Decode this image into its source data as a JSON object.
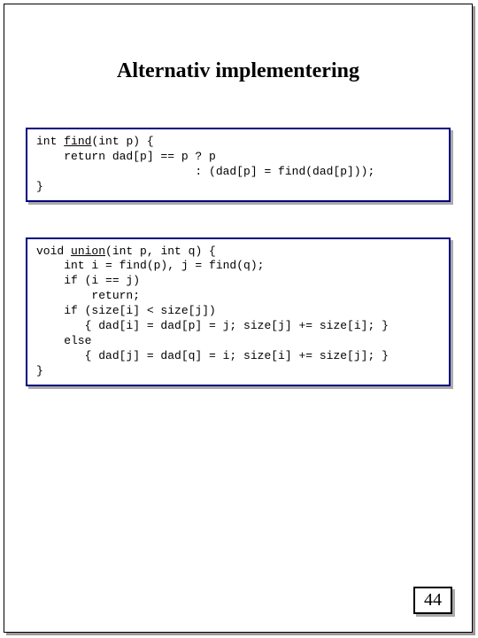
{
  "slide": {
    "title": "Alternativ implementering",
    "page_number": "44",
    "code1": {
      "line1_a": "int ",
      "line1_fn": "find",
      "line1_b": "(int p) {",
      "line2": "    return dad[p] == p ? p",
      "line3": "                       : (dad[p] = find(dad[p]));",
      "line4": "}"
    },
    "code2": {
      "line1_a": "void ",
      "line1_fn": "union",
      "line1_b": "(int p, int q) {",
      "line2": "    int i = find(p), j = find(q);",
      "line3": "    if (i == j)",
      "line4": "        return;",
      "line5": "    if (size[i] < size[j])",
      "line6": "       { dad[i] = dad[p] = j; size[j] += size[i]; }",
      "line7": "    else",
      "line8": "       { dad[j] = dad[q] = i; size[i] += size[j]; }",
      "line9": "}"
    }
  }
}
